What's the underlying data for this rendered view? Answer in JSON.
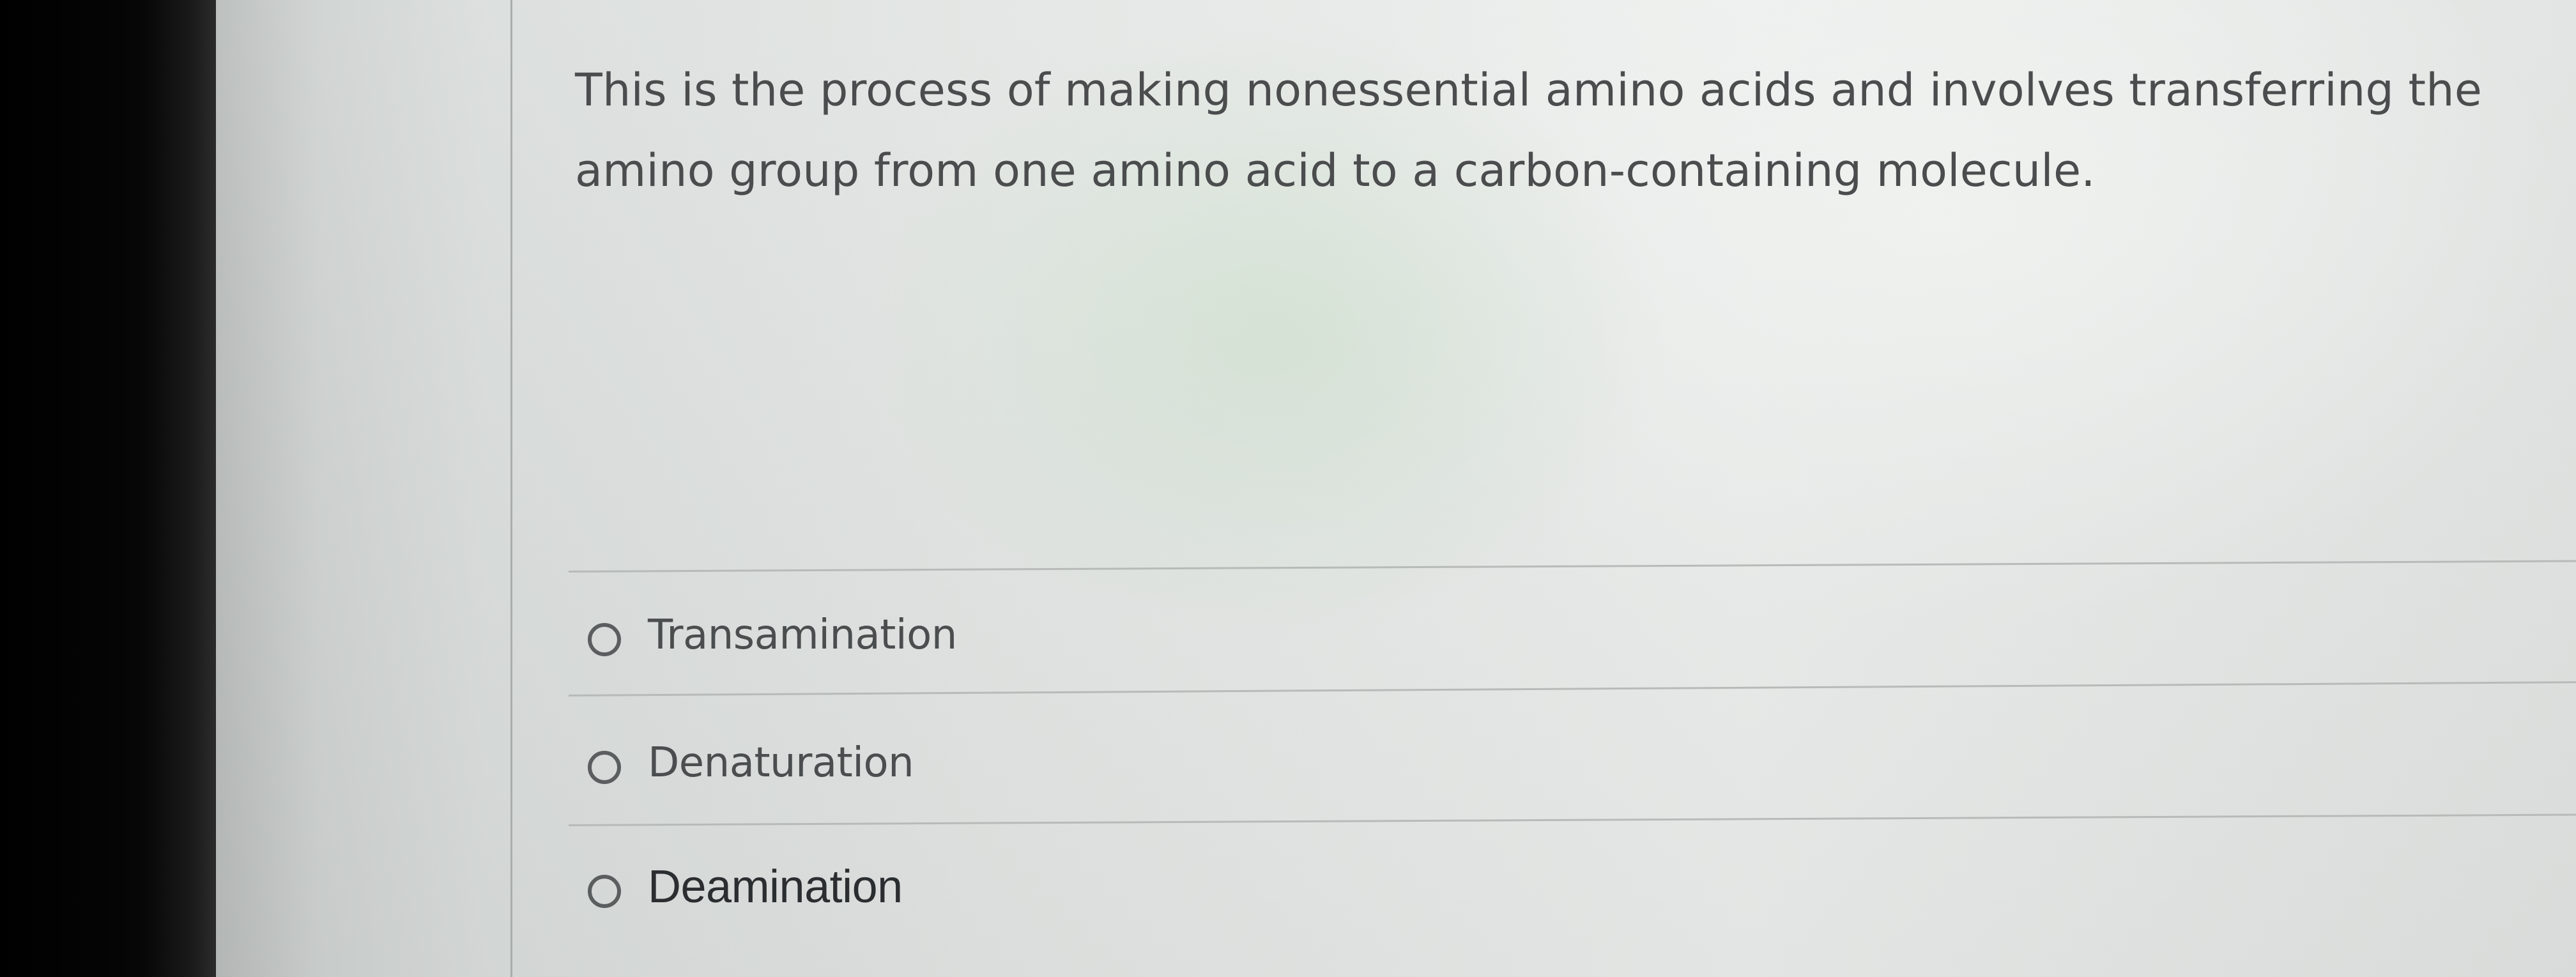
{
  "question": {
    "text": "This is the process of making nonessential amino acids and involves transferring the amino group from one amino acid to a carbon-containing molecule."
  },
  "options": [
    {
      "label": "Transamination",
      "selected": false
    },
    {
      "label": "Denaturation",
      "selected": false
    },
    {
      "label": "Deamination",
      "selected": false
    }
  ]
}
